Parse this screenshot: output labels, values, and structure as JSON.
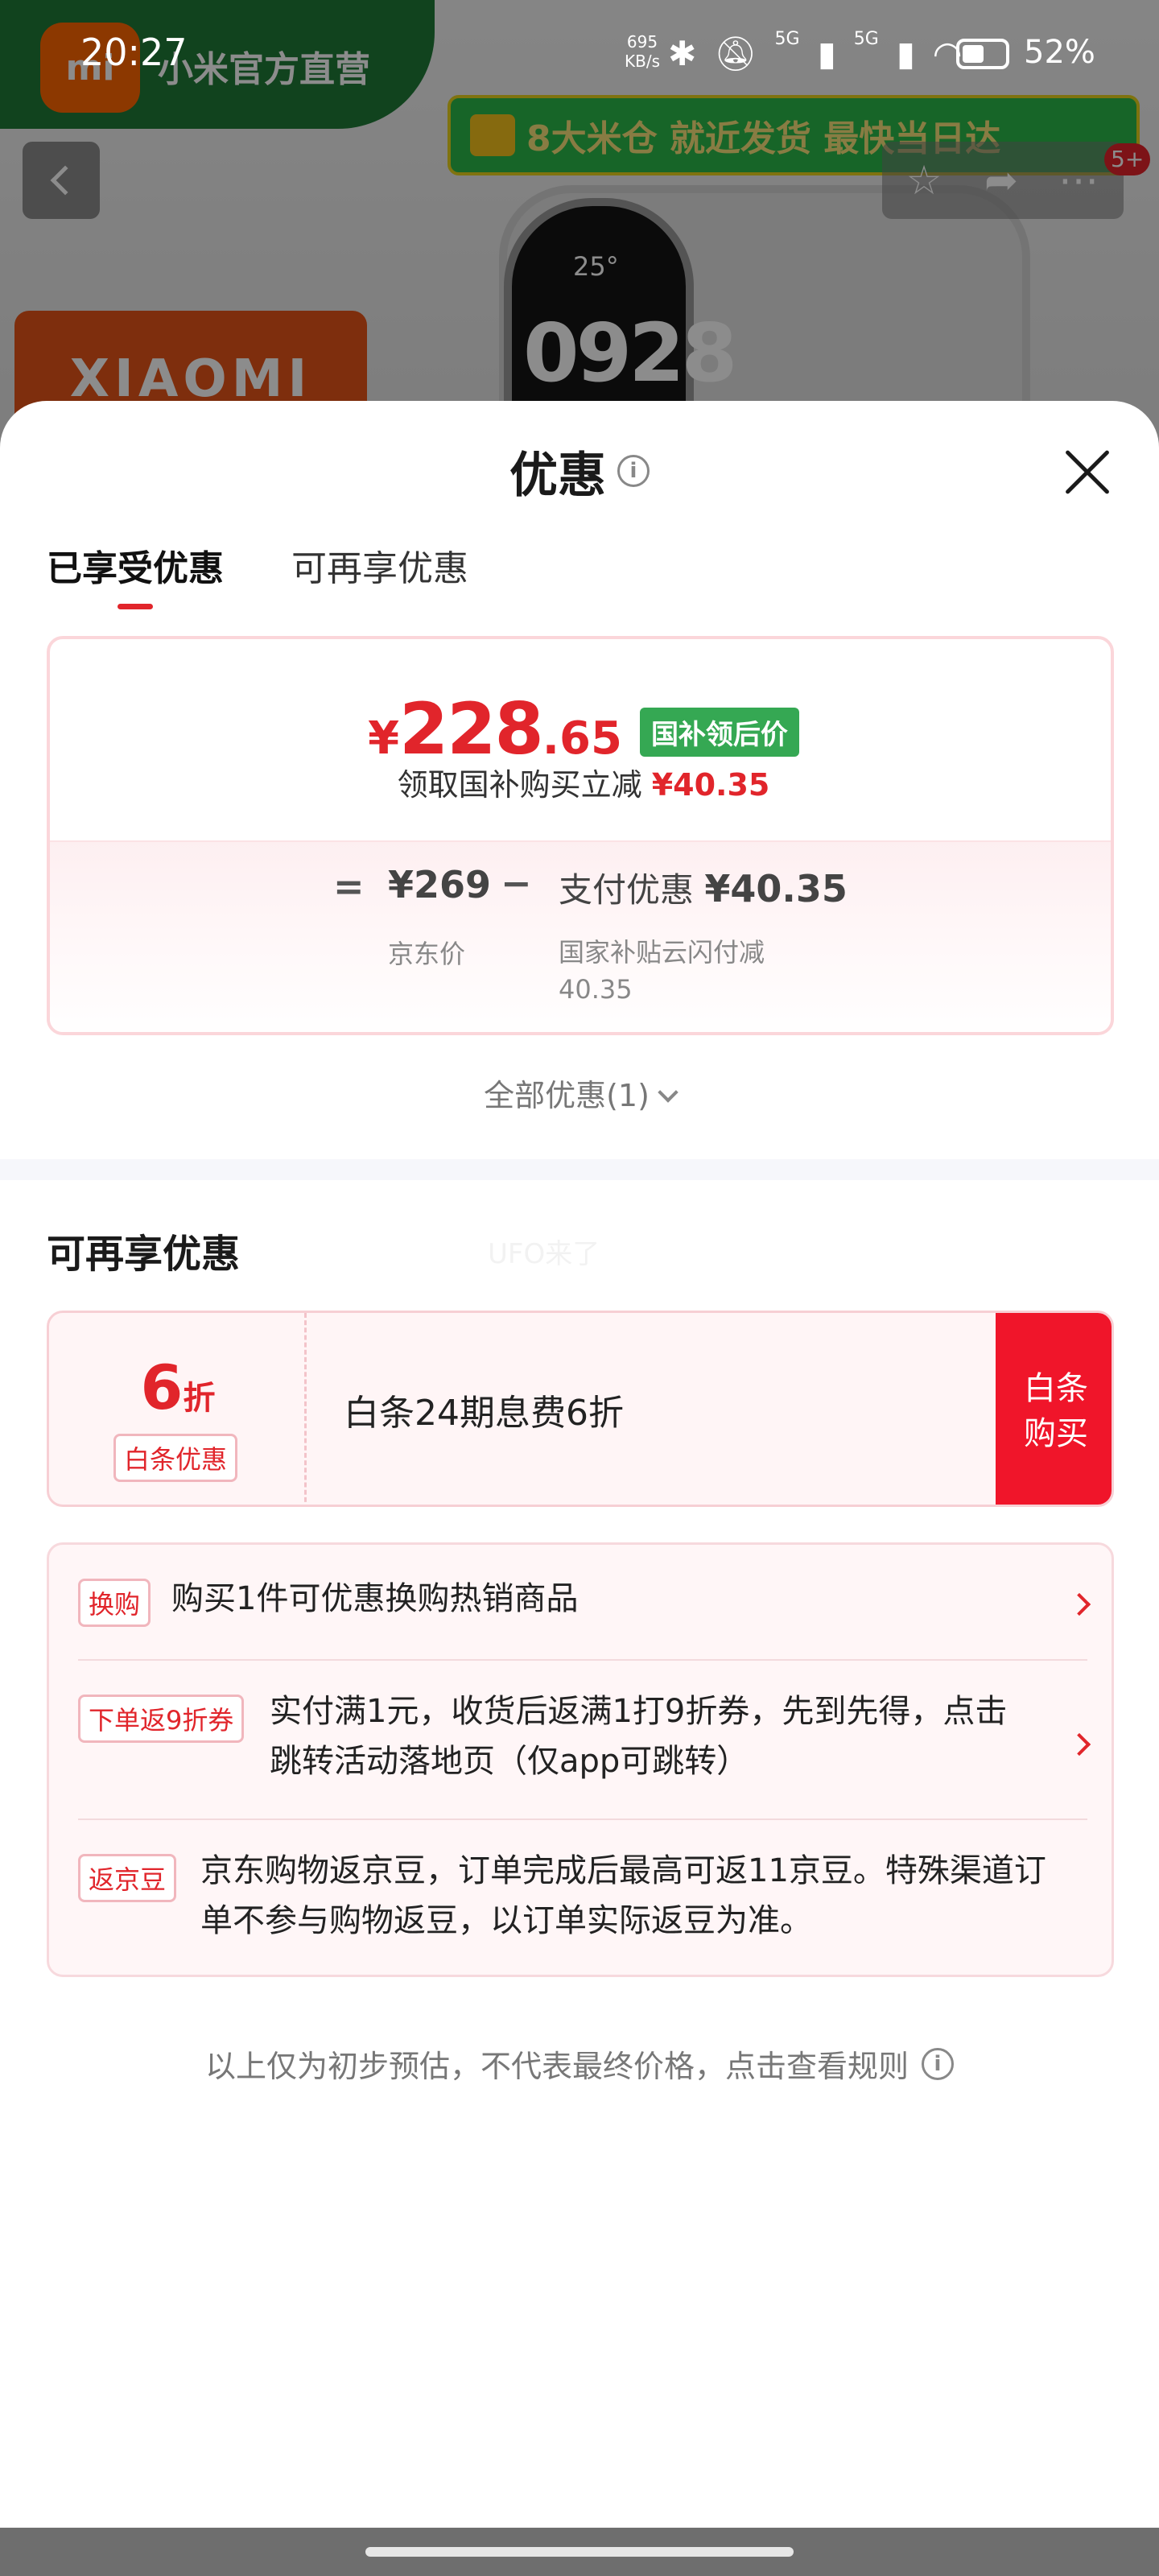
{
  "status_bar": {
    "time": "20:27",
    "net_speed": "695",
    "net_unit": "KB/s",
    "sig1": "5G",
    "sig2": "5G",
    "battery": "52%"
  },
  "background_page": {
    "store_logo": "mi",
    "store_name": "小米官方直营",
    "warehouse_banner": "8大米仓 就近发货 最快当日达",
    "brand": "XIAOMI",
    "watch_time": "0928",
    "watch_temp": "25°",
    "cart_badge": "5+"
  },
  "sheet": {
    "title": "优惠",
    "tabs": [
      {
        "label": "已享受优惠",
        "active": true
      },
      {
        "label": "可再享优惠",
        "active": false
      }
    ],
    "enjoyed": {
      "currency": "¥",
      "price_int": "228",
      "price_dec": ".65",
      "price_tag": "国补领后价",
      "claim_text": "领取国补购买立减",
      "claim_amount": "¥40.35",
      "equals": "=",
      "base_price": "¥269",
      "minus": "−",
      "pay_label": "支付优惠",
      "pay_amount": "¥40.35",
      "base_label": "京东价",
      "pay_desc": "国家补贴云闪付减",
      "pay_desc_amount": "40.35"
    },
    "all_offers": "全部优惠(1)",
    "more_section_title": "可再享优惠",
    "watermark": "UFO来了",
    "coupon": {
      "discount_num": "6",
      "discount_unit": "折",
      "tag": "白条优惠",
      "description": "白条24期息费6折",
      "buy_line1": "白条",
      "buy_line2": "购买"
    },
    "promotions": [
      {
        "tag": "换购",
        "text": "购买1件可优惠换购热销商品"
      },
      {
        "tag": "下单返9折券",
        "text_line1": "实付满1元，收货后返满1打9折券，先到先得，点击",
        "text_line2": "跳转活动落地页（仅app可跳转）"
      },
      {
        "tag": "返京豆",
        "text_line1": "京东购物返京豆，订单完成后最高可返11京豆。特殊渠道订",
        "text_line2": "单不参与购物返豆，以订单实际返豆为准。"
      }
    ],
    "footer_note": "以上仅为初步预估，不代表最终价格，点击查看规则"
  },
  "colors": {
    "accent_red": "#e1252b",
    "buy_red": "#f0152a",
    "gov_green": "#35a853"
  }
}
